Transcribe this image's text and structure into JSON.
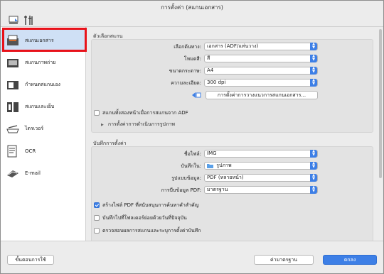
{
  "window": {
    "title": "การตั้งค่า (สแกนเอกสาร)"
  },
  "toolbar": {
    "icons": [
      "scan-settings-icon",
      "general-settings-icon"
    ]
  },
  "sidebar": {
    "items": [
      {
        "label": "สแกนเอกสาร",
        "icon": "document-scan-icon",
        "active": true
      },
      {
        "label": "สแกนภาพถ่าย",
        "icon": "photo-scan-icon",
        "active": false
      },
      {
        "label": "กำหนดสแกนเอง",
        "icon": "custom-scan-icon",
        "active": false
      },
      {
        "label": "สแกนและเย็บ",
        "icon": "scan-stitch-icon",
        "active": false
      },
      {
        "label": "ไดรเวอร์",
        "icon": "driver-icon",
        "active": false
      },
      {
        "label": "OCR",
        "icon": "ocr-icon",
        "active": false
      },
      {
        "label": "E-mail",
        "icon": "email-icon",
        "active": false
      }
    ]
  },
  "scan_options": {
    "section_title": "ตัวเลือกสแกน",
    "source_label": "เลือกต้นทาง:",
    "source_value": "เอกสาร (ADF/แท่นวาง)",
    "color_mode_label": "โหมดสี:",
    "color_mode_value": "สี",
    "paper_size_label": "ขนาดกระดาษ:",
    "paper_size_value": "A4",
    "resolution_label": "ความละเอียด:",
    "resolution_value": "300 dpi",
    "placement_button": "การตั้งค่าการวางแนวการสแกนเอกสาร...",
    "duplex_label": "สแกนทั้งสองหน้าเมื่อการสแกนจาก ADF",
    "duplex_checked": false,
    "image_processing_label": "การตั้งค่าการดำเนินการรูปภาพ"
  },
  "save_settings": {
    "section_title": "บันทึกการตั้งค่า",
    "filename_label": "ชื่อไฟล์:",
    "filename_value": "IMG",
    "save_in_label": "บันทึกใน:",
    "save_in_value": "รูปภาพ",
    "data_format_label": "รูปแบบข้อมูล:",
    "data_format_value": "PDF (หลายหน้า)",
    "pdf_compression_label": "การบีบข้อมูล PDF:",
    "pdf_compression_value": "มาตรฐาน",
    "check_keyword_label": "สร้างไฟล์ PDF ที่สนับสนุนการค้นหาคำสำคัญ",
    "check_keyword_checked": true,
    "check_subfolder_label": "บันทึกไปที่โฟลเดอร์ย่อยด้วยวันที่ปัจจุบัน",
    "check_subfolder_checked": false,
    "check_confirm_label": "ตรวจสอบผลการสแกนและระบุการตั้งค่าบันทึก",
    "check_confirm_checked": false
  },
  "footer": {
    "instructions_button": "ขั้นตอนการใช้",
    "defaults_button": "ค่ามาตรฐาน",
    "ok_button": "ตกลง"
  },
  "colors": {
    "accent": "#3d7fe6",
    "highlight_outline": "#e8121a",
    "selection": "#cfe0f5"
  }
}
